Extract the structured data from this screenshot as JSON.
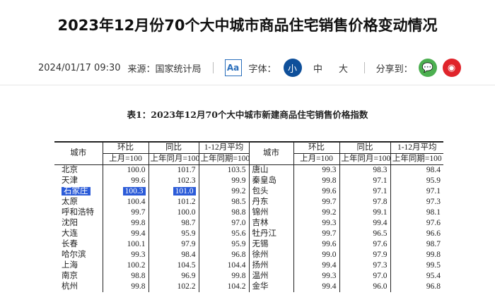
{
  "title": "2023年12月份70个大中城市商品住宅销售价格变动情况",
  "meta": {
    "datetime": "2024/01/17 09:30",
    "source": "来源：国家统计局",
    "aa": "Aa",
    "font_label": "字体：",
    "font_small": "小",
    "font_medium": "中",
    "font_large": "大",
    "share_label": "分享到："
  },
  "colors": {
    "accent": "#0e4f9a",
    "wechat": "#4caf50",
    "weibo": "#e0242b"
  },
  "table": {
    "caption": "表1：2023年12月70个大中城市新建商品住宅销售价格指数",
    "headers": {
      "city": "城市",
      "mom": "环比",
      "yoy": "同比",
      "avg": "1-12月平均",
      "mom_base": "上月=100",
      "yoy_base": "上年同月=100",
      "avg_base": "上年同期=100"
    },
    "left": [
      [
        "北京",
        "100.0",
        "101.7",
        "103.5"
      ],
      [
        "天津",
        "99.6",
        "102.3",
        "99.9"
      ],
      [
        "石家庄",
        "100.3",
        "101.0",
        "99.2"
      ],
      [
        "太原",
        "100.4",
        "101.2",
        "98.5"
      ],
      [
        "呼和浩特",
        "99.7",
        "100.0",
        "98.8"
      ],
      [
        "沈阳",
        "99.8",
        "98.7",
        "97.0"
      ],
      [
        "大连",
        "99.4",
        "95.9",
        "95.6"
      ],
      [
        "长春",
        "100.1",
        "97.9",
        "95.9"
      ],
      [
        "哈尔滨",
        "99.3",
        "98.4",
        "96.8"
      ],
      [
        "上海",
        "100.2",
        "104.5",
        "104.4"
      ],
      [
        "南京",
        "98.8",
        "96.9",
        "99.8"
      ],
      [
        "杭州",
        "99.8",
        "102.2",
        "104.2"
      ]
    ],
    "right": [
      [
        "唐山",
        "99.3",
        "98.3",
        "98.4"
      ],
      [
        "秦皇岛",
        "99.8",
        "97.1",
        "95.9"
      ],
      [
        "包头",
        "99.6",
        "97.1",
        "97.1"
      ],
      [
        "丹东",
        "99.7",
        "97.8",
        "97.3"
      ],
      [
        "锦州",
        "99.2",
        "99.1",
        "98.1"
      ],
      [
        "吉林",
        "99.3",
        "99.4",
        "97.6"
      ],
      [
        "牡丹江",
        "99.7",
        "96.5",
        "96.6"
      ],
      [
        "无锡",
        "99.6",
        "97.6",
        "98.7"
      ],
      [
        "徐州",
        "99.0",
        "97.9",
        "99.8"
      ],
      [
        "扬州",
        "99.4",
        "97.3",
        "99.5"
      ],
      [
        "温州",
        "99.3",
        "97.0",
        "95.4"
      ],
      [
        "金华",
        "99.4",
        "96.0",
        "96.8"
      ]
    ]
  }
}
